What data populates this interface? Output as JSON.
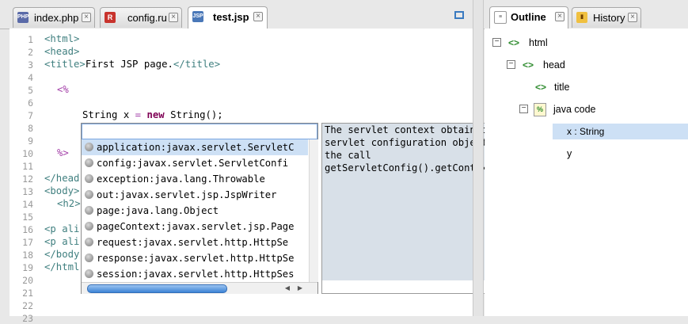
{
  "editor_tabs": [
    {
      "label": "index.php",
      "icon": "php-file-icon",
      "icon_text": "PHP",
      "active": false
    },
    {
      "label": "config.ru",
      "icon": "ruby-file-icon",
      "icon_text": "R",
      "active": false
    },
    {
      "label": "test.jsp",
      "icon": "jsp-file-icon",
      "icon_text": "JSP",
      "active": true
    }
  ],
  "line_numbers": [
    "1",
    "2",
    "3",
    "4",
    "5",
    "6",
    "7",
    "8",
    "9",
    "10",
    "11",
    "12",
    "13",
    "14",
    "15",
    "16",
    "17",
    "18",
    "19",
    "20",
    "21",
    "22",
    "23"
  ],
  "code": {
    "l1": "<html>",
    "l2": "<head>",
    "l3_tag_open": "<title>",
    "l3_text": "First JSP page.",
    "l3_tag_close": "</title>",
    "l5": "<%",
    "l7_type": "String",
    "l7_var": " x ",
    "l7_eq": "=",
    "l7_new": "new",
    "l7_rest": " String();",
    "l10": "%>",
    "l12": "</head",
    "l13": "<body>",
    "l14": "<h2>",
    "l16": "<p ali",
    "l17": "<p ali",
    "l18": "</body",
    "l19": "</html"
  },
  "completion": {
    "filter_value": "",
    "proposals": [
      "application:javax.servlet.ServletC",
      "config:javax.servlet.ServletConfi",
      "exception:java.lang.Throwable",
      "out:javax.servlet.jsp.JspWriter",
      "page:java.lang.Object",
      "pageContext:javax.servlet.jsp.Page",
      "request:javax.servlet.http.HttpSe",
      "response:javax.servlet.http.HttpSe",
      "session:javax.servlet.http.HttpSes"
    ],
    "selected_index": 0,
    "proposal_icon_glyph": "●"
  },
  "doc": {
    "text": "The servlet context obtained from the servlet configuration object (as in the call getServletConfig().getContext())"
  },
  "outline_tabs": [
    {
      "label": "Outline",
      "active": true,
      "icon": "outline-icon"
    },
    {
      "label": "History",
      "active": false,
      "icon": "history-icon"
    }
  ],
  "outline": {
    "nodes": [
      {
        "label": "html",
        "toggle": "⊟",
        "icon": "<>"
      },
      {
        "label": "head",
        "toggle": "⊟",
        "icon": "<>"
      },
      {
        "label": "title",
        "toggle": "",
        "icon": "<>"
      },
      {
        "label": "java code",
        "toggle": "⊟",
        "icon": "%"
      },
      {
        "label": "x : String",
        "toggle": "",
        "icon": ""
      },
      {
        "label": "y",
        "toggle": "",
        "icon": ""
      }
    ]
  },
  "colors": {
    "selection": "#cde0f5",
    "doc_background": "#d8e0e8",
    "tag": "#3f7f7f",
    "keyword": "#7f0055"
  }
}
